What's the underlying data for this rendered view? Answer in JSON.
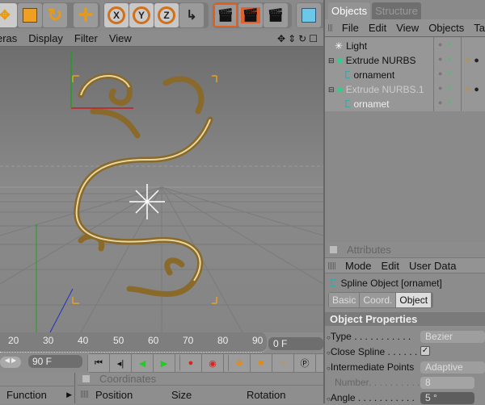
{
  "toolbar": {
    "buttons": [
      "move-tool",
      "scale-tool",
      "rotate-tool",
      "live-select",
      "x-axis-lock",
      "y-axis-lock",
      "z-axis-lock",
      "coordinate-system",
      "render-view",
      "render-picture-viewer",
      "render-settings",
      "cube-primitive"
    ],
    "axis_labels": [
      "X",
      "Y",
      "Z"
    ]
  },
  "viewport": {
    "menu": [
      "eras",
      "Display",
      "Filter",
      "View"
    ],
    "nav_icons": [
      "move-view-icon",
      "zoom-view-icon",
      "rotate-view-icon",
      "maximize-view-icon"
    ],
    "ornament_color": "#8a6a2a"
  },
  "timeline": {
    "ticks": [
      "20",
      "30",
      "40",
      "50",
      "60",
      "70",
      "80",
      "90"
    ],
    "current_frame": "0 F",
    "end_frame": "90 F"
  },
  "objects_panel": {
    "tabs": [
      "Objects",
      "Structure"
    ],
    "active_tab": "Objects",
    "menu": [
      "File",
      "Edit",
      "View",
      "Objects",
      "Ta"
    ],
    "items": [
      {
        "name": "Light",
        "indent": 0,
        "icon": "light-icon",
        "dim": false
      },
      {
        "name": "Extrude NURBS",
        "indent": 0,
        "icon": "extrude-icon",
        "dim": false
      },
      {
        "name": "ornament",
        "indent": 1,
        "icon": "spline-icon",
        "dim": false
      },
      {
        "name": "Extrude NURBS.1",
        "indent": 0,
        "icon": "extrude-icon",
        "dim": true
      },
      {
        "name": "ornamet",
        "indent": 1,
        "icon": "spline-icon",
        "dim": true
      }
    ]
  },
  "attributes_panel": {
    "title": "Attributes",
    "menu": [
      "Mode",
      "Edit",
      "User Data"
    ],
    "object_title": "Spline Object [ornamet]",
    "tabs": [
      "Basic",
      "Coord.",
      "Object"
    ],
    "active_tab": "Object",
    "section": "Object Properties",
    "props": [
      {
        "label": "Type",
        "dots": " . . . . . . . . . . .",
        "value": "Bezier"
      },
      {
        "label": "Close Spline",
        "dots": " . . . . . .",
        "value": "checked"
      },
      {
        "label": "Intermediate Points",
        "dots": "",
        "value": "Adaptive"
      },
      {
        "label": "Number",
        "dots": ". . . . . . . . . .",
        "value": "8"
      },
      {
        "label": "Angle",
        "dots": " . . . . . . . . . . .",
        "value": "5 °"
      }
    ]
  },
  "coordinates_panel": {
    "title": "Coordinates",
    "columns": [
      "Position",
      "Size",
      "Rotation"
    ]
  },
  "left_panel": {
    "function_label": "Function"
  }
}
